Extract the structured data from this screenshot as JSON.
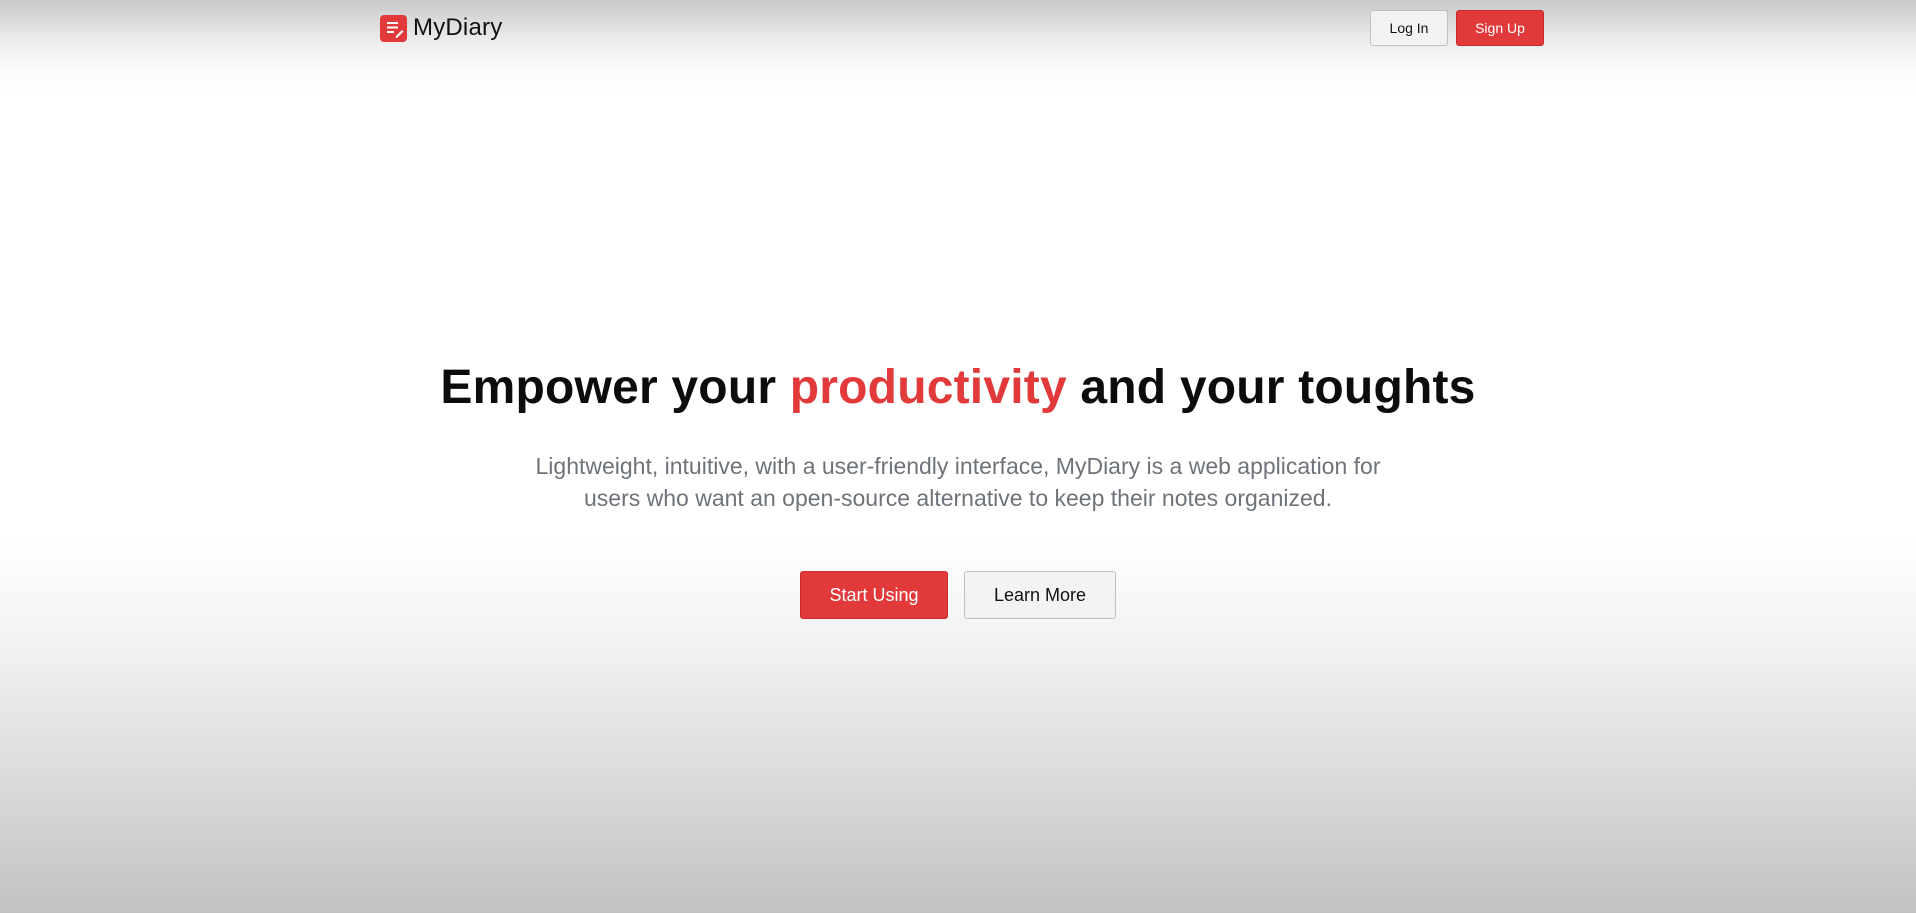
{
  "header": {
    "brand_name": "MyDiary",
    "brand_icon": "note-icon",
    "login_label": "Log In",
    "signup_label": "Sign Up"
  },
  "hero": {
    "title_part1": "Empower your ",
    "title_accent": "productivity",
    "title_part2": " and your toughts",
    "subtitle": "Lightweight, intuitive, with a user-friendly interface, MyDiary is a web application for users who want an open-source alternative to keep their notes organized.",
    "start_label": "Start Using",
    "learn_label": "Learn More"
  },
  "colors": {
    "accent": "#e23a3a",
    "subtitle_text": "#6e737a"
  }
}
